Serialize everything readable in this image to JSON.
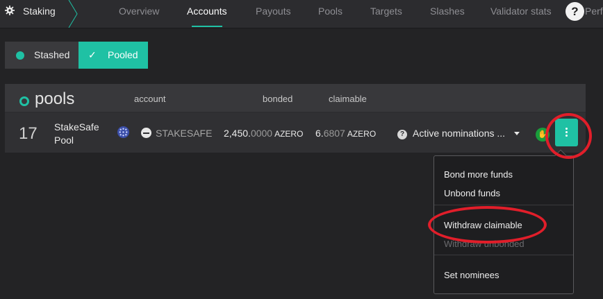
{
  "nav": {
    "brand": "Staking",
    "tabs": [
      {
        "label": "Overview"
      },
      {
        "label": "Accounts"
      },
      {
        "label": "Payouts"
      },
      {
        "label": "Pools"
      },
      {
        "label": "Targets"
      },
      {
        "label": "Slashes"
      },
      {
        "label": "Validator stats"
      }
    ],
    "active_tab": "Accounts",
    "help": "?",
    "overflow_label": "Perfo"
  },
  "view_toggle": {
    "stashed_label": "Stashed",
    "pooled_label": "Pooled",
    "selected": "Pooled"
  },
  "pools_table": {
    "title": "pools",
    "columns": {
      "account": "account",
      "bonded": "bonded",
      "claimable": "claimable"
    },
    "rows": [
      {
        "index": "17",
        "name_line1": "StakeSafe",
        "name_line2": "Pool",
        "account": "STAKESAFE",
        "bonded_int": "2,450.",
        "bonded_dec": "0000",
        "bonded_unit": "AZERO",
        "claimable_int": "6.",
        "claimable_dec": "6807",
        "claimable_unit": "AZERO",
        "nominations": "Active nominations ..."
      }
    ]
  },
  "actions_menu": {
    "items": [
      {
        "label": "Bond more funds",
        "enabled": true
      },
      {
        "label": "Unbond funds",
        "enabled": true
      },
      {
        "label": "Withdraw claimable",
        "enabled": true
      },
      {
        "label": "Withdraw unbonded",
        "enabled": false
      },
      {
        "label": "Set nominees",
        "enabled": true
      }
    ]
  },
  "colors": {
    "accent": "#1fc1a4",
    "annotation": "#e11e2a",
    "background": "#232325"
  }
}
